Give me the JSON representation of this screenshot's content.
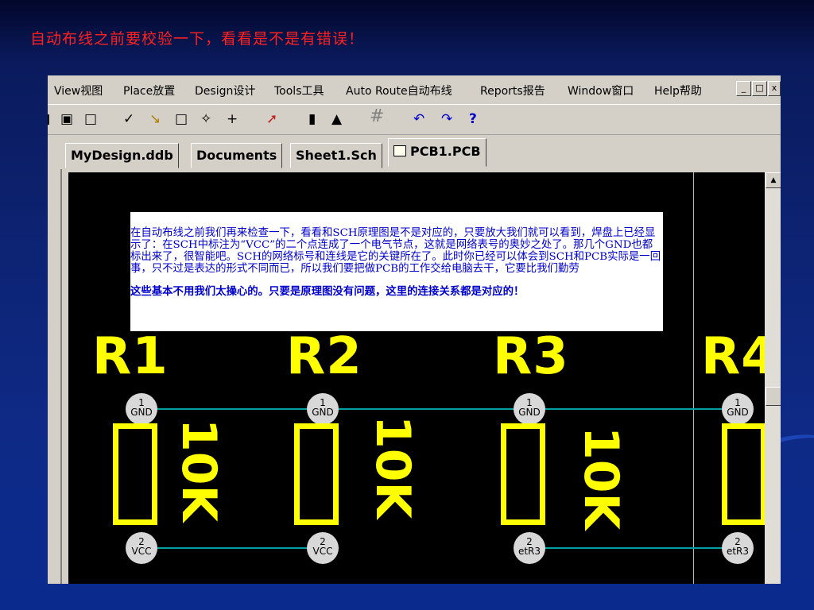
{
  "slide": {
    "title": "自动布线之前要校验一下，看看是不是有错误！"
  },
  "menu": {
    "items": [
      {
        "label": "View视图"
      },
      {
        "label": "Place放置"
      },
      {
        "label": "Design设计"
      },
      {
        "label": "Tools工具"
      },
      {
        "label": "Auto Route自动布线"
      },
      {
        "label": "Reports报告"
      },
      {
        "label": "Window窗口"
      },
      {
        "label": "Help帮助"
      }
    ],
    "window_buttons": {
      "minimize": "_",
      "restore": "🗗"
    }
  },
  "tabs": [
    {
      "label": "MyDesign.ddb",
      "active": false
    },
    {
      "label": "Documents",
      "active": false
    },
    {
      "label": "Sheet1.Sch",
      "active": false
    },
    {
      "label": "PCB1.PCB",
      "active": true
    }
  ],
  "note": {
    "paragraph1": "在自动布线之前我们再来检查一下，看看和SCH原理图是不是对应的，只要放大我们就可以看到，焊盘上已经显示了：在SCH中标注为“VCC”的二个点连成了一个电气节点，这就是网络表号的奥妙之处了。那几个GND也都标出来了，很智能吧。SCH的网络标号和连线是它的关键所在了。此时你已经可以体会到SCH和PCB实际是一回事，只不过是表达的形式不同而已，所以我们要把做PCB的工作交给电脑去干，它要比我们勤劳",
    "paragraph2": "这些基本不用我们太操心的。只要是原理图没有问题，这里的连接关系都是对应的！"
  },
  "components": [
    {
      "ref": "R1",
      "value": "10K",
      "pad1_num": "1",
      "pad1_net": "GND",
      "pad2_num": "2",
      "pad2_net": "VCC"
    },
    {
      "ref": "R2",
      "value": "10K",
      "pad1_num": "1",
      "pad1_net": "GND",
      "pad2_num": "2",
      "pad2_net": "VCC"
    },
    {
      "ref": "R3",
      "value": "10K",
      "pad1_num": "1",
      "pad1_net": "GND",
      "pad2_num": "2",
      "pad2_net": "etR3"
    },
    {
      "ref": "R4",
      "value": "",
      "pad1_num": "1",
      "pad1_net": "GND",
      "pad2_num": "2",
      "pad2_net": "etR3"
    }
  ],
  "colors": {
    "slide_title": "#ff2020",
    "silkscreen": "#ffff00",
    "pcb_background": "#000000",
    "ratsnest": "#00a0a0",
    "pad": "#d8d8d8",
    "note_text": "#0000cc"
  }
}
